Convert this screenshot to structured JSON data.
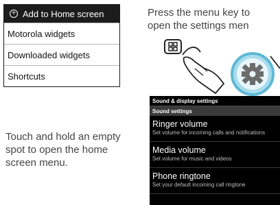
{
  "menu": {
    "title": "Add to Home screen",
    "items": [
      "Motorola widgets",
      "Downloaded widgets",
      "Shortcuts"
    ]
  },
  "captions": {
    "left": "Touch and hold an empty spot to open the home screen menu.",
    "right_line1": "Press the menu key to",
    "right_line2": "open the settings men"
  },
  "phone": {
    "title": "Sound & display settings",
    "section": "Sound settings",
    "settings": [
      {
        "title": "Ringer volume",
        "desc": "Set volume for incoming calls and notifications"
      },
      {
        "title": "Media volume",
        "desc": "Set volume for music and videos"
      },
      {
        "title": "Phone ringtone",
        "desc": "Set your default incoming call ringtone"
      }
    ]
  },
  "icons": {
    "menu_header_icon": "plus-circle-icon",
    "menu_key_icon": "menu-key-icon",
    "settings_icon": "gear-icon",
    "hand_icon": "pointing-hand-icon"
  }
}
